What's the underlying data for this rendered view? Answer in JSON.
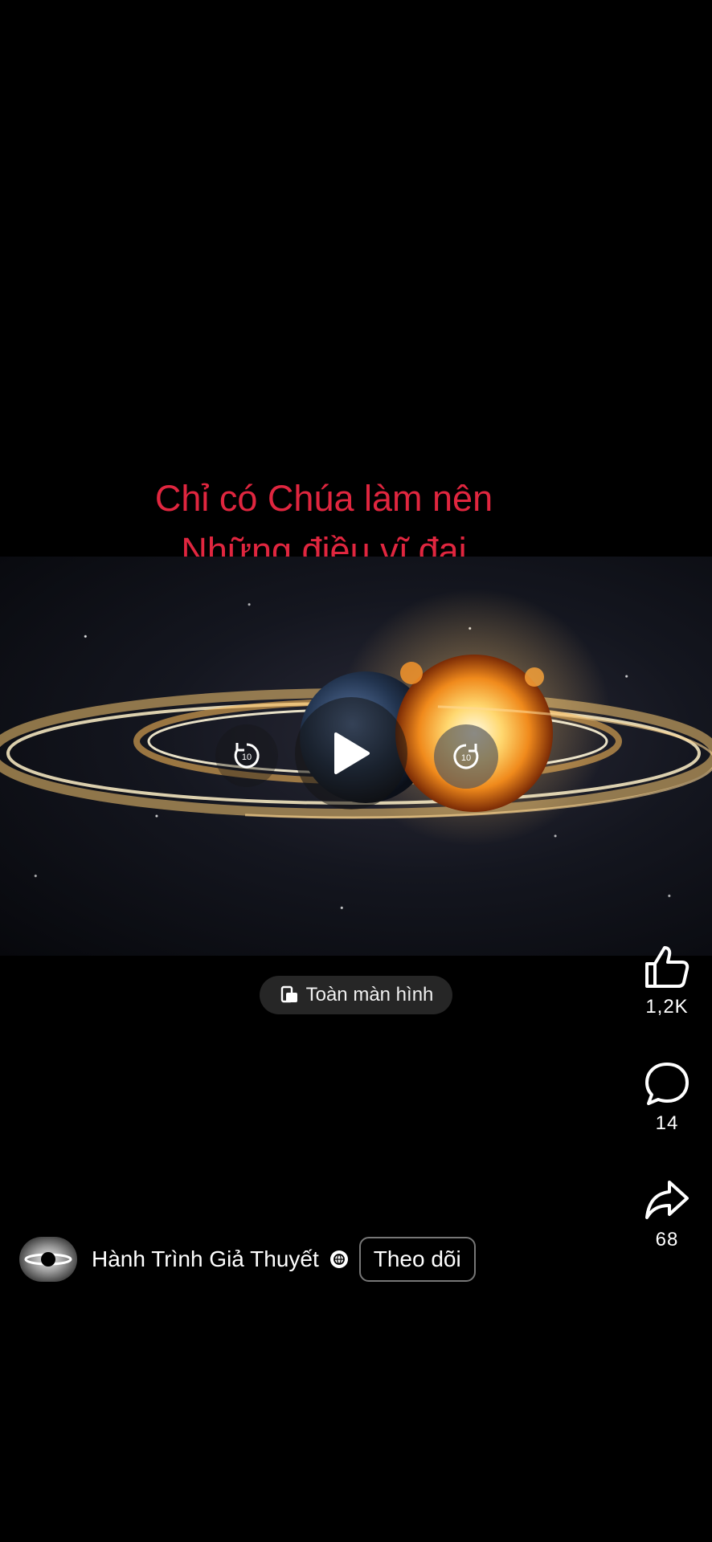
{
  "caption": {
    "line1": "Chỉ có Chúa làm nên",
    "line2": "Những điều vĩ đại",
    "color": "#e0263f"
  },
  "video": {
    "rewind_label": "10",
    "forward_label": "10",
    "play_icon": "play-icon"
  },
  "fullscreen_button": {
    "label": "Toàn màn hình",
    "icon": "fullscreen-rotate-icon"
  },
  "actions": {
    "like_count": "1,2K",
    "comment_count": "14",
    "share_count": "68"
  },
  "channel": {
    "name": "Hành Trình Giả Thuyết",
    "follow_label": "Theo dõi"
  }
}
